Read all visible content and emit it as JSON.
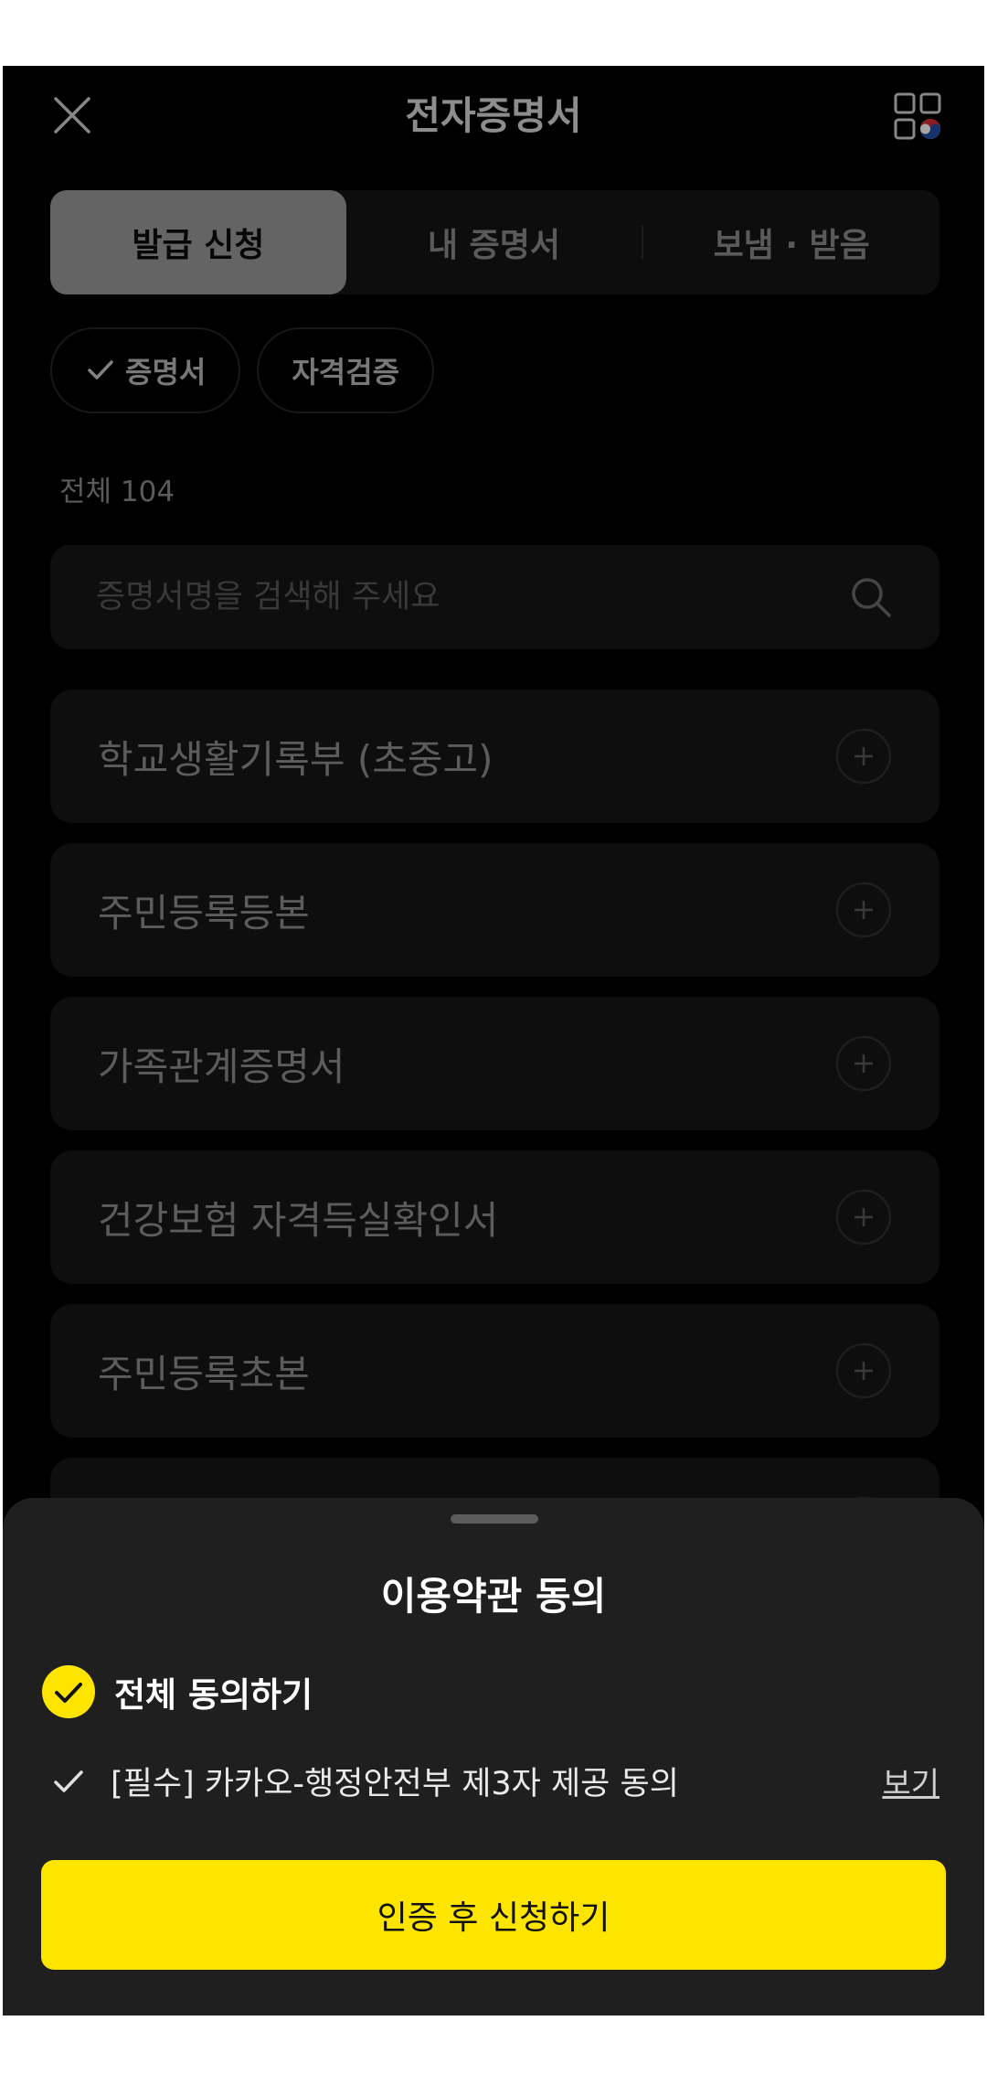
{
  "header": {
    "title": "전자증명서",
    "close_icon": "close-icon",
    "gov_icon": "korea-gov-apps-icon"
  },
  "tabs": [
    {
      "label": "발급 신청",
      "active": true
    },
    {
      "label": "내 증명서",
      "active": false
    },
    {
      "label": "보냄 · 받음",
      "active": false
    }
  ],
  "chips": [
    {
      "label": "증명서",
      "selected": true
    },
    {
      "label": "자격검증",
      "selected": false
    }
  ],
  "count_label": "전체 104",
  "search": {
    "placeholder": "증명서명을 검색해 주세요"
  },
  "items": [
    {
      "label": "학교생활기록부 (초중고)"
    },
    {
      "label": "주민등록등본"
    },
    {
      "label": "가족관계증명서"
    },
    {
      "label": "건강보험 자격득실확인서"
    },
    {
      "label": "주민등록초본"
    },
    {
      "label": ""
    }
  ],
  "sheet": {
    "title": "이용약관 동의",
    "agree_all_label": "전체 동의하기",
    "term_label": "[필수] 카카오-행정안전부 제3자 제공 동의",
    "view_label": "보기",
    "cta_label": "인증 후 신청하기"
  },
  "colors": {
    "accent": "#fee500",
    "background": "#000000",
    "sheet_bg": "#1f1f1f"
  }
}
